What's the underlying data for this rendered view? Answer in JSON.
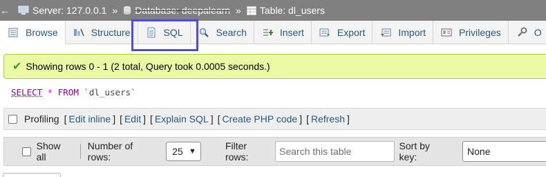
{
  "breadcrumb": {
    "back": "←",
    "server": "Server: 127.0.0.1",
    "separator": "»",
    "database": "Database: deepalearn",
    "table": "Table: dl_users"
  },
  "tabs": [
    {
      "label": "Browse",
      "icon": "browse-icon",
      "active": true
    },
    {
      "label": "Structure",
      "icon": "structure-icon",
      "active": false
    },
    {
      "label": "SQL",
      "icon": "sql-icon",
      "active": false
    },
    {
      "label": "Search",
      "icon": "search-icon",
      "active": false
    },
    {
      "label": "Insert",
      "icon": "insert-icon",
      "active": false
    },
    {
      "label": "Export",
      "icon": "export-icon",
      "active": false
    },
    {
      "label": "Import",
      "icon": "import-icon",
      "active": false
    },
    {
      "label": "Privileges",
      "icon": "privileges-icon",
      "active": false
    },
    {
      "label": "O",
      "icon": "operations-icon",
      "active": false
    }
  ],
  "success": {
    "message": "Showing rows 0 - 1 (2 total, Query took 0.0005 seconds.)"
  },
  "sql": {
    "select": "SELECT",
    "star": "*",
    "from": "FROM",
    "table": "`dl_users`"
  },
  "profiling": {
    "label": "Profiling",
    "links": [
      "Edit inline",
      "Edit",
      "Explain SQL",
      "Create PHP code",
      "Refresh"
    ]
  },
  "navbar": {
    "show_all": "Show all",
    "rows_label": "Number of rows:",
    "rows_value": "25",
    "filter_label": "Filter rows:",
    "filter_placeholder": "Search this table",
    "sort_label": "Sort by key:",
    "sort_value": "None"
  },
  "colors": {
    "link": "#235a81",
    "highlight": "#4d4dd6",
    "success_bg": "#ebf8a4"
  }
}
